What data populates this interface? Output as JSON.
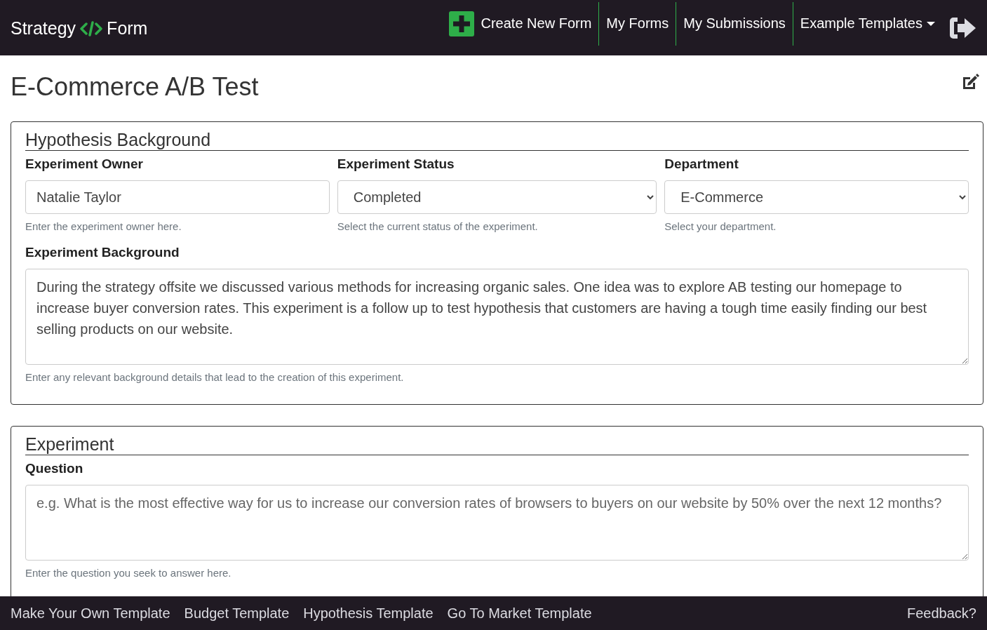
{
  "navbar": {
    "brand": {
      "left": "Strategy",
      "right": "Form"
    },
    "links": [
      {
        "label": "Create New Form",
        "kind": "create"
      },
      {
        "label": "My Forms",
        "kind": "plain"
      },
      {
        "label": "My Submissions",
        "kind": "plain"
      },
      {
        "label": "Example Templates",
        "kind": "dropdown"
      }
    ]
  },
  "page": {
    "title": "E-Commerce A/B Test"
  },
  "sections": [
    {
      "legend": "Hypothesis Background",
      "rows": [
        [
          {
            "label": "Experiment Owner",
            "kind": "text",
            "value": "Natalie Taylor",
            "help": "Enter the experiment owner here."
          },
          {
            "label": "Experiment Status",
            "kind": "select",
            "value": "Completed",
            "help": "Select the current status of the experiment."
          },
          {
            "label": "Department",
            "kind": "select",
            "value": "E-Commerce",
            "help": "Select your department."
          }
        ],
        [
          {
            "label": "Experiment Background",
            "kind": "textarea",
            "value": "During the strategy offsite we discussed various methods for increasing organic sales. One idea was to explore AB testing our homepage to increase buyer conversion rates. This experiment is a follow up to test hypothesis that customers are having a tough time easily finding our best selling products on our website.",
            "help": "Enter any relevant background details that lead to the creation of this experiment."
          }
        ]
      ]
    },
    {
      "legend": "Experiment",
      "rows": [
        [
          {
            "label": "Question",
            "kind": "textarea",
            "placeholder": "e.g. What is the most effective way for us to increase our conversion rates of browsers to buyers on our website by 50% over the next 12 months?",
            "help": "Enter the question you seek to answer here."
          }
        ]
      ]
    }
  ],
  "footer": {
    "links": [
      "Make Your Own Template",
      "Budget Template",
      "Hypothesis Template",
      "Go To Market Template"
    ],
    "feedback": "Feedback?"
  }
}
